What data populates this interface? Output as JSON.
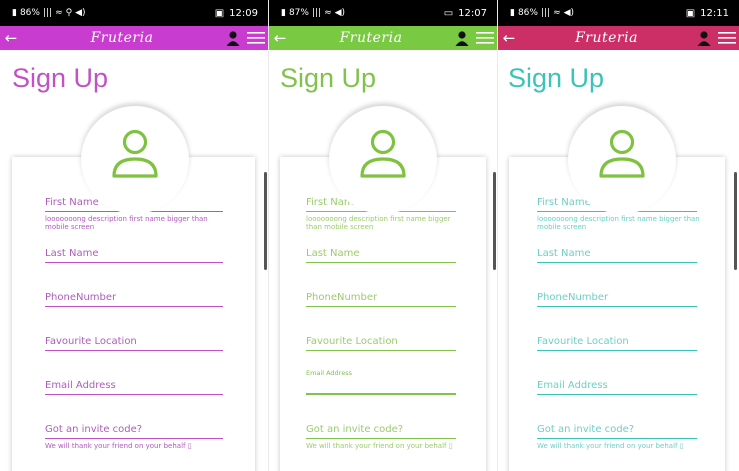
{
  "screens": [
    {
      "status": {
        "battery": "86%",
        "signal": "|||",
        "wifi": "≈",
        "extra": "⚲ ◀)",
        "time": "12:09",
        "clock_icon": "▣"
      },
      "appbar": {
        "back": "←",
        "brand": "Fruteria"
      },
      "colors": {
        "appbar": "#c83ccf",
        "accent": "#c152c5",
        "profile": "#7fc241",
        "field_text": "#b05bbf"
      },
      "title": "Sign Up",
      "fields": {
        "first_name": "First Name",
        "first_name_desc": "looooooong description first name bigger than mobile screen",
        "last_name": "Last Name",
        "phone": "PhoneNumber",
        "location": "Favourite Location",
        "email": "Email Address",
        "invite": "Got an invite code?",
        "invite_desc": "We will thank your friend on your behalf ▯"
      }
    },
    {
      "status": {
        "battery": "87%",
        "signal": "|||",
        "wifi": "≈",
        "extra": "◀)",
        "time": "12:07",
        "clock_icon": "▭"
      },
      "appbar": {
        "back": "←",
        "brand": "Fruteria"
      },
      "colors": {
        "appbar": "#7ac943",
        "accent": "#80c24b",
        "profile": "#7fc241",
        "field_text": "#9ccb6d"
      },
      "title": "Sign Up",
      "fields": {
        "first_name": "First Name",
        "first_name_desc": "looooooong description first name bigger than mobile screen",
        "last_name": "Last Name",
        "phone": "PhoneNumber",
        "location": "Favourite Location",
        "email": "Email Address",
        "invite": "Got an invite code?",
        "invite_desc": "We will thank your friend on your behalf ▯"
      }
    },
    {
      "status": {
        "battery": "86%",
        "signal": "|||",
        "wifi": "≈",
        "extra": "◀)",
        "time": "12:11",
        "clock_icon": "▣"
      },
      "appbar": {
        "back": "←",
        "brand": "Fruteria"
      },
      "colors": {
        "appbar": "#cc2f66",
        "accent": "#3cc3b8",
        "profile": "#7fc241",
        "field_text": "#6dcfc6"
      },
      "title": "Sign Up",
      "fields": {
        "first_name": "First Name",
        "first_name_desc": "looooooong description first name bigger than mobile screen",
        "last_name": "Last Name",
        "phone": "PhoneNumber",
        "location": "Favourite Location",
        "email": "Email Address",
        "invite": "Got an invite code?",
        "invite_desc": "We will thank your friend on your behalf ▯"
      }
    }
  ]
}
